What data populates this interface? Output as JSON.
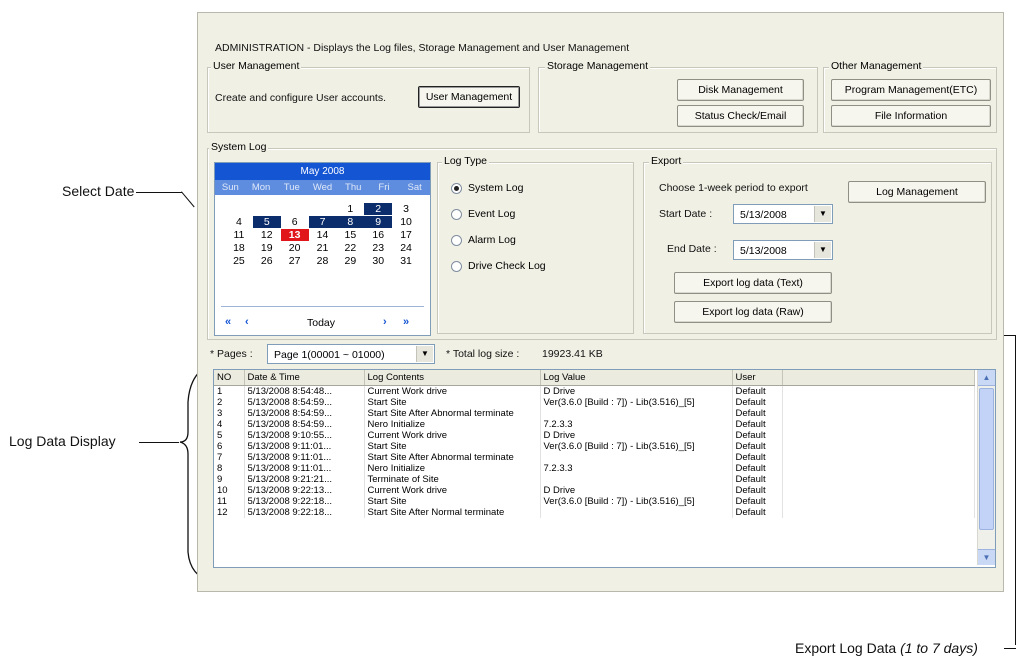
{
  "window": {
    "title": "ADMINISTRATION - Displays the Log files,  Storage Management and User Management"
  },
  "user_management": {
    "group_label": "User Management",
    "description": "Create and configure User accounts.",
    "button": "User Management"
  },
  "storage_management": {
    "group_label": "Storage Management",
    "disk_button": "Disk Management",
    "status_button": "Status Check/Email"
  },
  "other_management": {
    "group_label": "Other Management",
    "program_button": "Program Management(ETC)",
    "file_button": "File Information"
  },
  "system_log": {
    "group_label": "System Log",
    "calendar": {
      "month_title": "May 2008",
      "weekdays": [
        "Sun",
        "Mon",
        "Tue",
        "Wed",
        "Thu",
        "Fri",
        "Sat"
      ],
      "days": [
        "",
        "",
        "",
        "",
        "1",
        "2",
        "3",
        "4",
        "5",
        "6",
        "7",
        "8",
        "9",
        "10",
        "11",
        "12",
        "13",
        "14",
        "15",
        "16",
        "17",
        "18",
        "19",
        "20",
        "21",
        "22",
        "23",
        "24",
        "25",
        "26",
        "27",
        "28",
        "29",
        "30",
        "31"
      ],
      "selected_days": [
        "2",
        "5",
        "7",
        "8",
        "9"
      ],
      "today_day": "13",
      "prev_year_icon": "«",
      "prev_month_icon": "‹",
      "today_label": "Today",
      "next_month_icon": "›",
      "next_year_icon": "»"
    },
    "log_type": {
      "group_label": "Log Type",
      "options": [
        "System Log",
        "Event Log",
        "Alarm Log",
        "Drive Check Log"
      ],
      "selected": "System Log"
    },
    "export": {
      "group_label": "Export",
      "instruction": "Choose 1-week period to export",
      "start_label": "Start Date :",
      "start_value": "5/13/2008",
      "end_label": "End Date :",
      "end_value": "5/13/2008",
      "export_text_button": "Export log data (Text)",
      "export_raw_button": "Export log data (Raw)",
      "log_management_button": "Log Management"
    }
  },
  "pages": {
    "label": "* Pages :",
    "value": "Page 1(00001 ~ 01000)",
    "total_label": "* Total log size :",
    "total_value": "19923.41 KB"
  },
  "log_table": {
    "columns": [
      "NO",
      "Date & Time",
      "Log Contents",
      "Log Value",
      "User"
    ],
    "rows": [
      [
        "1",
        "5/13/2008 8:54:48...",
        "Current Work drive",
        "D Drive",
        "Default"
      ],
      [
        "2",
        "5/13/2008 8:54:59...",
        "Start Site",
        "Ver(3.6.0 [Build : 7]) - Lib(3.516)_[5]",
        "Default"
      ],
      [
        "3",
        "5/13/2008 8:54:59...",
        "Start Site After Abnormal terminate",
        "",
        "Default"
      ],
      [
        "4",
        "5/13/2008 8:54:59...",
        "Nero Initialize",
        "7.2.3.3",
        "Default"
      ],
      [
        "5",
        "5/13/2008 9:10:55...",
        "Current Work drive",
        "D Drive",
        "Default"
      ],
      [
        "6",
        "5/13/2008 9:11:01...",
        "Start Site",
        "Ver(3.6.0 [Build : 7]) - Lib(3.516)_[5]",
        "Default"
      ],
      [
        "7",
        "5/13/2008 9:11:01...",
        "Start Site After Abnormal terminate",
        "",
        "Default"
      ],
      [
        "8",
        "5/13/2008 9:11:01...",
        "Nero Initialize",
        "7.2.3.3",
        "Default"
      ],
      [
        "9",
        "5/13/2008 9:21:21...",
        "Terminate of Site",
        "",
        "Default"
      ],
      [
        "10",
        "5/13/2008 9:22:13...",
        "Current Work drive",
        "D Drive",
        "Default"
      ],
      [
        "11",
        "5/13/2008 9:22:18...",
        "Start Site",
        "Ver(3.6.0 [Build : 7]) - Lib(3.516)_[5]",
        "Default"
      ],
      [
        "12",
        "5/13/2008 9:22:18...",
        "Start Site After Normal terminate",
        "",
        "Default"
      ]
    ]
  },
  "annotations": {
    "select_date": "Select Date",
    "log_data_display": "Log Data Display",
    "export_log_data": "Export Log Data",
    "export_log_data_note": "(1 to 7 days)"
  },
  "colors": {
    "calendar_header": "#1455d4",
    "selected_day": "#0c2d6b",
    "today_day": "#e1161a",
    "window_background": "#f1f0e5"
  }
}
